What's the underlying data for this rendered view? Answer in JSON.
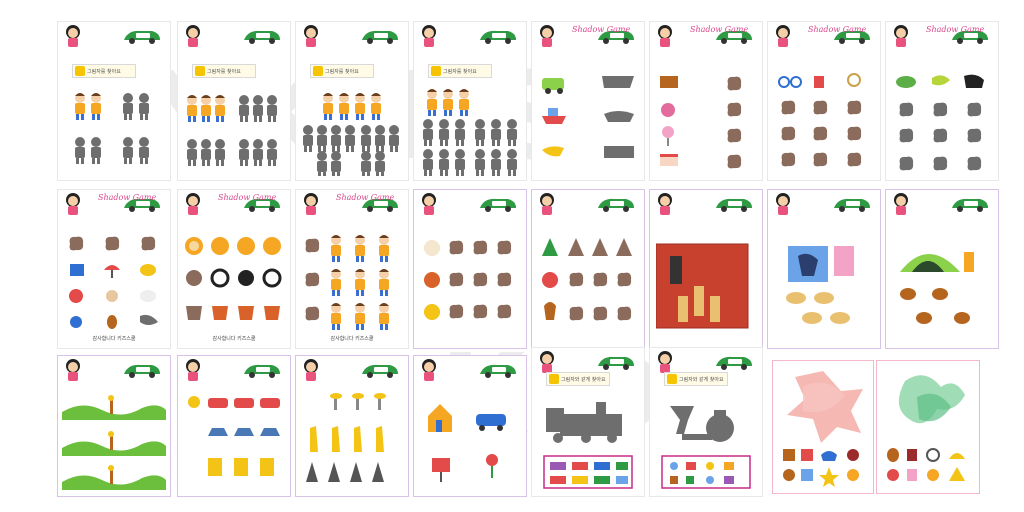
{
  "footer_text": "감사합니다 키즈스쿨",
  "shadow_logo": "Shadow Game",
  "title_label": "그림자를 찾아요",
  "title_label_alt": "그림자와 같게 찾아요",
  "watermark_top": "YKIDS",
  "watermark_bottom": "KIDS",
  "colors": {
    "frame_pink": "#f2b8c8",
    "green_car": "#2f9a44",
    "shadow_gray": "#6e6e6e",
    "shadow_brown": "#8a6b5c",
    "flag_red": "#e8433a",
    "flag_blue": "#2e6fd1",
    "flag_yellow": "#f3c316"
  },
  "sheets": [
    {
      "row": 1,
      "col": 1,
      "subject": "two children",
      "shadow": "gray",
      "has_title": true
    },
    {
      "row": 1,
      "col": 2,
      "subject": "three children",
      "shadow": "gray",
      "has_title": true
    },
    {
      "row": 1,
      "col": 3,
      "subject": "four children",
      "shadow": "gray",
      "has_title": true
    },
    {
      "row": 1,
      "col": 4,
      "subject": "crowd of children",
      "shadow": "gray",
      "has_title": true
    },
    {
      "row": 1,
      "col": 5,
      "subject": "vehicles matching",
      "shadow": "gray",
      "has_logo": true
    },
    {
      "row": 1,
      "col": 6,
      "subject": "sweets matching",
      "shadow": "brown",
      "has_logo": true
    },
    {
      "row": 1,
      "col": 7,
      "subject": "objects matching",
      "shadow": "brown",
      "has_logo": true
    },
    {
      "row": 1,
      "col": 8,
      "subject": "animals matching",
      "shadow": "gray",
      "has_logo": true
    },
    {
      "row": 2,
      "col": 1,
      "subject": "objects grid",
      "shadow": "brown",
      "has_logo": true
    },
    {
      "row": 2,
      "col": 2,
      "subject": "lion panda fox",
      "shadow": "mixed",
      "has_logo": true
    },
    {
      "row": 2,
      "col": 3,
      "subject": "kids in uniforms",
      "shadow": "brown",
      "has_logo": true
    },
    {
      "row": 2,
      "col": 4,
      "subject": "animals grid",
      "shadow": "brown"
    },
    {
      "row": 2,
      "col": 5,
      "subject": "christmas items",
      "shadow": "brown"
    },
    {
      "row": 2,
      "col": 6,
      "subject": "firefighters scene",
      "shadow": "dark"
    },
    {
      "row": 2,
      "col": 7,
      "subject": "playground scene",
      "shadow": "dark"
    },
    {
      "row": 2,
      "col": 8,
      "subject": "camping bears",
      "shadow": "dark"
    },
    {
      "row": 3,
      "col": 1,
      "subject": "hills and signs",
      "shadow": "green"
    },
    {
      "row": 3,
      "col": 2,
      "subject": "cars and boats",
      "shadow": "mixed"
    },
    {
      "row": 3,
      "col": 3,
      "subject": "giraffes and trees",
      "shadow": "mixed"
    },
    {
      "row": 3,
      "col": 4,
      "subject": "house car flower",
      "shadow": "mixed"
    },
    {
      "row": 3,
      "col": 5,
      "subject": "train silhouette",
      "shadow": "gray",
      "has_title": true
    },
    {
      "row": 3,
      "col": 6,
      "subject": "kettle silhouette",
      "shadow": "gray",
      "has_title": true
    },
    {
      "row": 3,
      "col": 7,
      "subject": "overlapping shapes",
      "shadow": "pink"
    },
    {
      "row": 3,
      "col": 8,
      "subject": "overlapping leaves",
      "shadow": "green"
    }
  ]
}
